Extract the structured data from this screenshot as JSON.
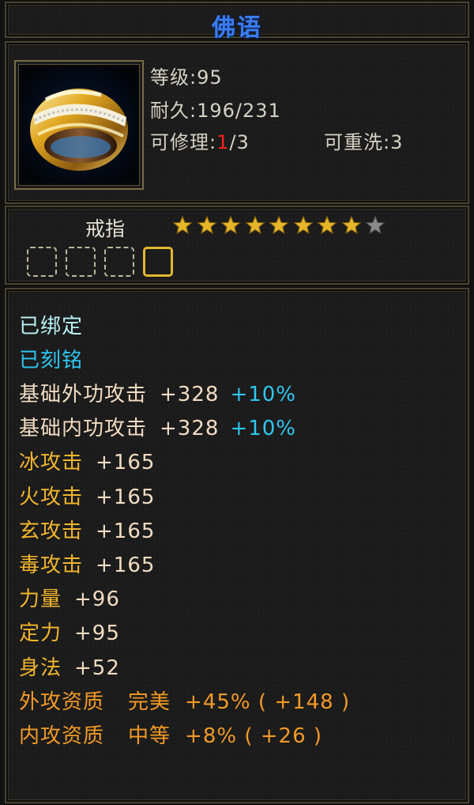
{
  "header": {
    "title": "佛语"
  },
  "item": {
    "icon": "gold-ring-icon",
    "level_label": "等级:",
    "level": "95",
    "durability_label": "耐久:",
    "durability": "196/231",
    "repair_label": "可修理:",
    "repair_used": "1",
    "repair_total": "/3",
    "rewash_label": "可重洗:",
    "rewash": "3",
    "type": "戒指",
    "stars_filled": 8,
    "stars_total": 9,
    "sockets": [
      false,
      false,
      false,
      true
    ]
  },
  "attributes": {
    "bound": "已绑定",
    "engraved": "已刻铭",
    "lines": [
      {
        "label": "基础外功攻击",
        "value": "+328",
        "bonus": "+10%"
      },
      {
        "label": "基础内功攻击",
        "value": "+328",
        "bonus": "+10%"
      },
      {
        "label": "冰攻击",
        "value": "+165"
      },
      {
        "label": "火攻击",
        "value": "+165"
      },
      {
        "label": "玄攻击",
        "value": "+165"
      },
      {
        "label": "毒攻击",
        "value": "+165"
      },
      {
        "label": "力量",
        "value": "+96"
      },
      {
        "label": "定力",
        "value": "+95"
      },
      {
        "label": "身法",
        "value": "+52"
      }
    ],
    "qualities": [
      {
        "label": "外攻资质",
        "grade": "完美",
        "value": "+45% ( +148 )"
      },
      {
        "label": "内攻资质",
        "grade": "中等",
        "value": "+8% ( +26 )"
      }
    ]
  },
  "colors": {
    "title": "#3a7cf0",
    "star_gold": "#e6b52a",
    "star_gray": "#8a8a8a",
    "bonus_cyan": "#2ec6f0",
    "quality_orange": "#f39a26"
  }
}
